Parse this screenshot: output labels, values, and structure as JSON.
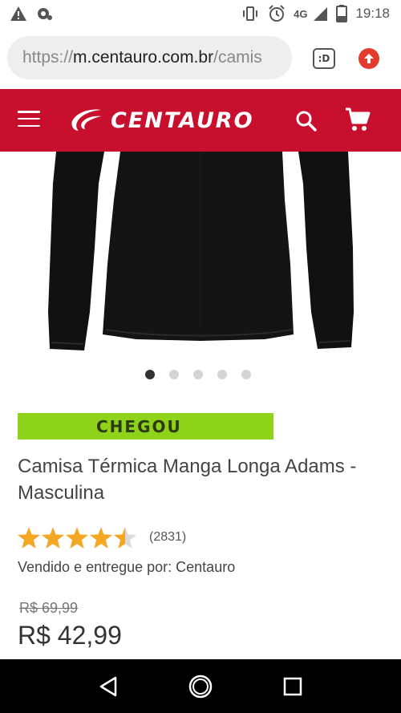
{
  "status_bar": {
    "time": "19:18",
    "network": "4G"
  },
  "browser": {
    "url_scheme": "https://",
    "url_host": "m.centauro.com.br",
    "url_path": "/camis",
    "tabs_label": ":D"
  },
  "header": {
    "brand": "CENTAURO",
    "brand_color": "#c8102e"
  },
  "carousel": {
    "total_slides": 5,
    "active_slide": 1
  },
  "product": {
    "badge": "CHEGOU",
    "badge_color": "#8fd21a",
    "title": "Camisa Térmica Manga Longa Adams - Masculina",
    "rating": 4.5,
    "rating_max": 5,
    "review_count": "(2831)",
    "seller": "Vendido e entregue por: Centauro",
    "old_price": "R$ 69,99",
    "price": "R$ 42,99"
  },
  "colors": {
    "star": "#f5a623",
    "star_empty": "#d9d9d9"
  }
}
